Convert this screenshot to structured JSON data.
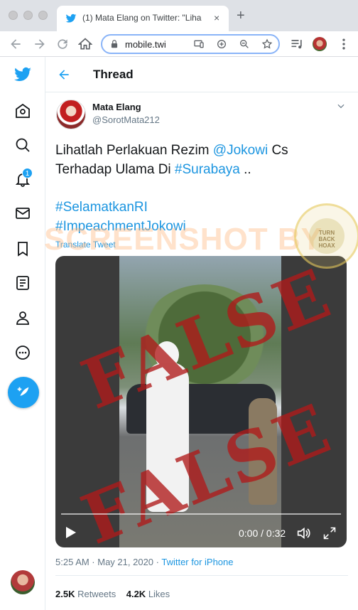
{
  "browser": {
    "tab_title": "(1) Mata Elang on Twitter: \"Liha",
    "url": "mobile.twi",
    "close_glyph": "×",
    "new_tab_glyph": "+"
  },
  "nav": {
    "notification_count": "1"
  },
  "thread": {
    "title": "Thread"
  },
  "tweet": {
    "display_name": "Mata Elang",
    "handle": "@SorotMata212",
    "text_prefix": "Lihatlah Perlakuan Rezim ",
    "mention": "@Jokowi",
    "text_middle": " Cs Terhadap Ulama Di ",
    "hashtag_city": "#Surabaya",
    "text_suffix": " ..",
    "hashtag_1": "#SelamatkanRI",
    "hashtag_2": "#ImpeachmentJokowi",
    "translate_label": "Translate Tweet",
    "video_time": "0:00 / 0:32",
    "video_stamp": "FALSE",
    "timestamp": "5:25 AM · May 21, 2020 · ",
    "source": "Twitter for iPhone",
    "retweets_count": "2.5K",
    "retweets_label": " Retweets",
    "likes_count": "4.2K",
    "likes_label": " Likes"
  },
  "overlay": {
    "watermark": "SCREENSHOT BY",
    "seal_text": "TURN BACK HOAX"
  },
  "colors": {
    "twitter_blue": "#1da1f2",
    "link_blue": "#1b95e0",
    "stamp_red": "#b01a1a"
  }
}
